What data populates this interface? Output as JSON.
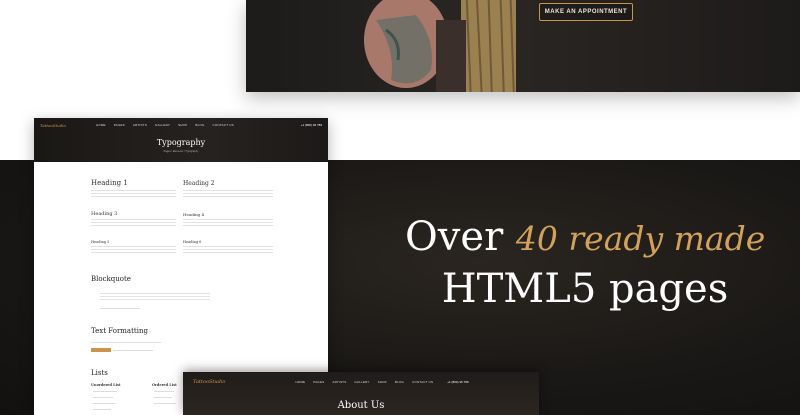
{
  "hero": {
    "button_label": "MAKE AN APPOINTMENT"
  },
  "typography_page": {
    "logo": "TattooStudio",
    "nav": [
      "HOME",
      "PAGES",
      "ARTISTS",
      "GALLERY",
      "SHOP",
      "BLOG",
      "CONTACT US"
    ],
    "phone": "+1 (800) 36 789",
    "title": "Typography",
    "breadcrumb": "Pages  /  Elements  /  Typography",
    "headings": {
      "h1": "Heading 1",
      "h2": "Heading 2",
      "h3": "Heading 3",
      "h4": "Heading 4",
      "h5": "Heading 5",
      "h6": "Heading 6"
    },
    "blockquote_title": "Blockquote",
    "text_formatting_title": "Text Formatting",
    "lists_title": "Lists",
    "unordered_list": "Unordered List",
    "ordered_list": "Ordered List"
  },
  "headline": {
    "prefix": "Over ",
    "accent": "40 ready made",
    "line2": "HTML5 pages"
  },
  "about_page": {
    "logo": "TattooStudio",
    "nav": [
      "HOME",
      "PAGES",
      "ARTISTS",
      "GALLERY",
      "SHOP",
      "BLOG",
      "CONTACT US"
    ],
    "phone": "+1 (800) 36 789",
    "title": "About Us"
  },
  "colors": {
    "accent": "#d3a15c",
    "dark_bg": "#1a1816"
  }
}
